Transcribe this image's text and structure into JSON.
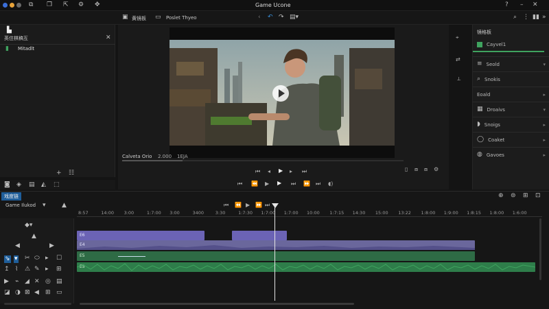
{
  "app": {
    "title": "Game Ucone"
  },
  "tabs": [
    {
      "label": "黄镜板"
    },
    {
      "label": "Poslet Thyeo"
    }
  ],
  "left_panel": {
    "header": "英住棋稿互",
    "item": "Mitadlt"
  },
  "viewer": {
    "status_left": "Calveta Orio",
    "status_mid": "2.000",
    "status_right": "1EJA"
  },
  "right_panel": {
    "header": "镜格板",
    "items": [
      {
        "label": "Cayvel1",
        "icon": "green-square-icon"
      },
      {
        "label": "Seold",
        "icon": "list-icon"
      },
      {
        "label": "Snokis",
        "icon": "search-icon"
      },
      {
        "label": "Eoald",
        "icon": "none"
      },
      {
        "label": "Droaivs",
        "icon": "grid-icon"
      },
      {
        "label": "Snoigs",
        "icon": "tag-icon"
      },
      {
        "label": "Coaket",
        "icon": "circle-icon"
      },
      {
        "label": "Gavoes",
        "icon": "globe-icon"
      }
    ]
  },
  "timeline": {
    "tab_label": "戏度链",
    "sequence_label": "Game Ilukod",
    "ruler": [
      "8:57",
      "14:00",
      "3:00",
      "1:7:00",
      "3:00",
      "3400",
      "3:30",
      "1:7:30",
      "1:7:00",
      "1:7:00",
      "10:00",
      "1:7:15",
      "14:30",
      "15:00",
      "13:22",
      "1:8:00",
      "1:9:00",
      "1:8:15",
      "1:8:00",
      "1:6:00"
    ],
    "clip_labels": [
      "E6",
      "E4",
      "E5",
      "E5"
    ]
  },
  "colors": {
    "accent": "#3a8fd8",
    "video_track": "#6b63b5",
    "audio_track": "#2e7d4a",
    "audio_wave": "#3fa35f"
  }
}
